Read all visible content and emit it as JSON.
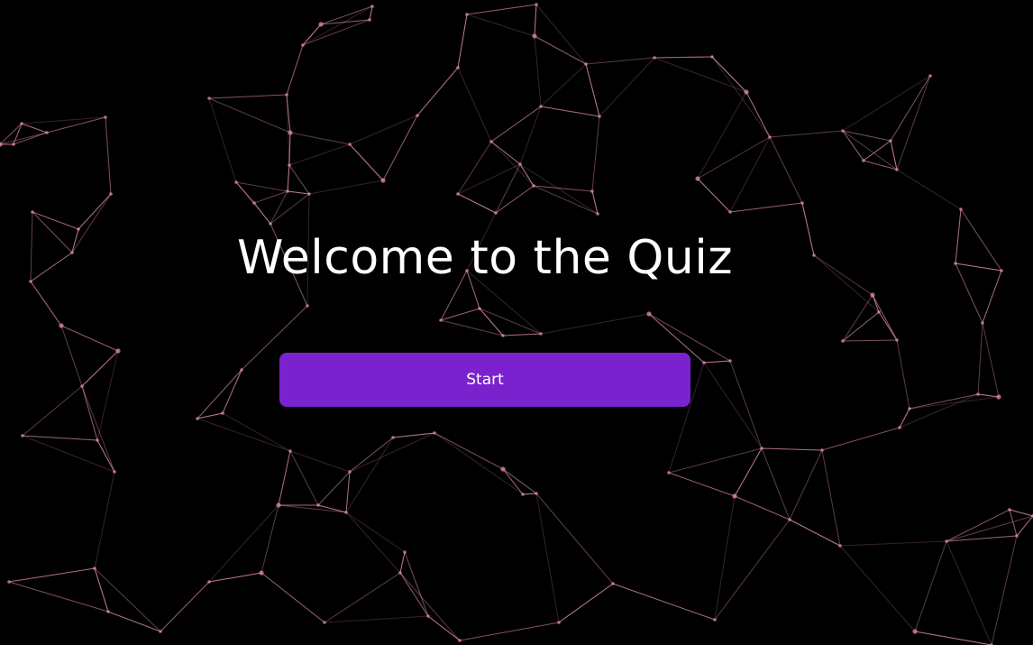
{
  "page": {
    "title": "Welcome to the Quiz",
    "start_label": "Start"
  },
  "background": {
    "base_color": "#000000",
    "line_color": "#d98ab0",
    "node_color": "#e08ab3"
  },
  "button": {
    "color": "#7b22cf"
  }
}
